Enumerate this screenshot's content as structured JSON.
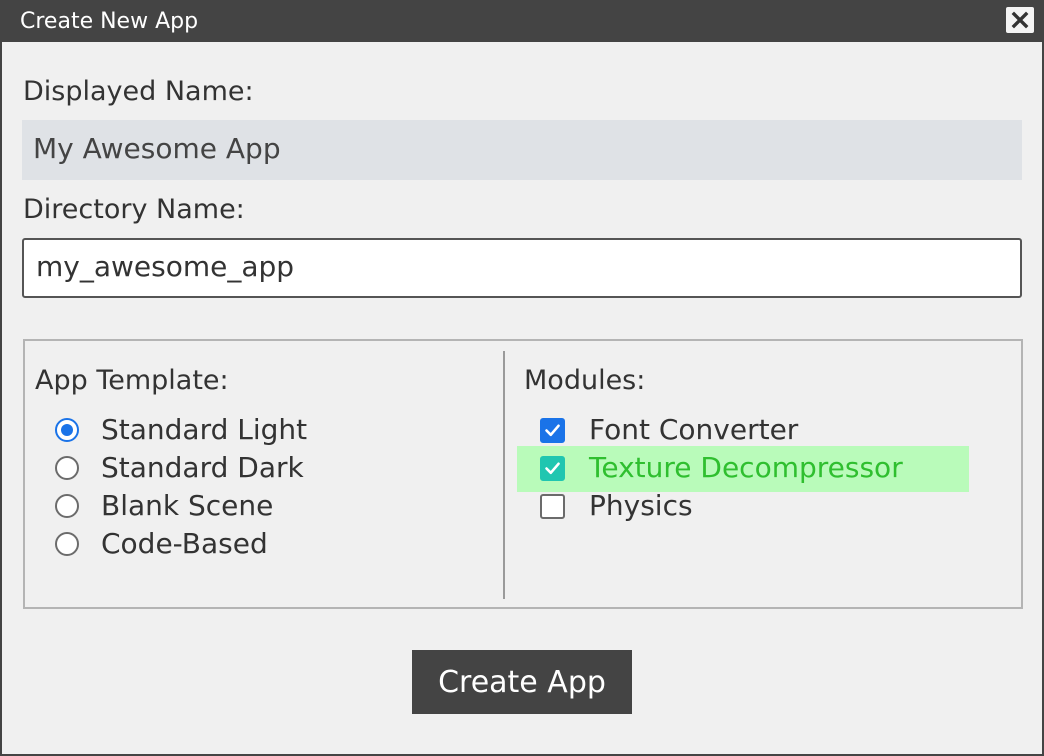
{
  "window": {
    "title": "Create New App"
  },
  "form": {
    "displayed_name_label": "Displayed Name:",
    "displayed_name_value": "My Awesome App",
    "directory_name_label": "Directory Name:",
    "directory_name_value": "my_awesome_app"
  },
  "template": {
    "title": "App Template:",
    "options": [
      {
        "label": "Standard Light",
        "selected": true
      },
      {
        "label": "Standard Dark",
        "selected": false
      },
      {
        "label": "Blank Scene",
        "selected": false
      },
      {
        "label": "Code-Based",
        "selected": false
      }
    ]
  },
  "modules": {
    "title": "Modules:",
    "items": [
      {
        "label": "Font Converter",
        "checked": true
      },
      {
        "label": "Texture Decompressor",
        "checked": true,
        "highlighted": true
      },
      {
        "label": "Physics",
        "checked": false
      }
    ]
  },
  "actions": {
    "create_label": "Create App"
  },
  "colors": {
    "titlebar": "#444444",
    "accent": "#1a73e8",
    "highlight_bg": "#b9fbba",
    "highlight_text": "#2fbf2f",
    "highlight_check": "#20c6b0"
  }
}
